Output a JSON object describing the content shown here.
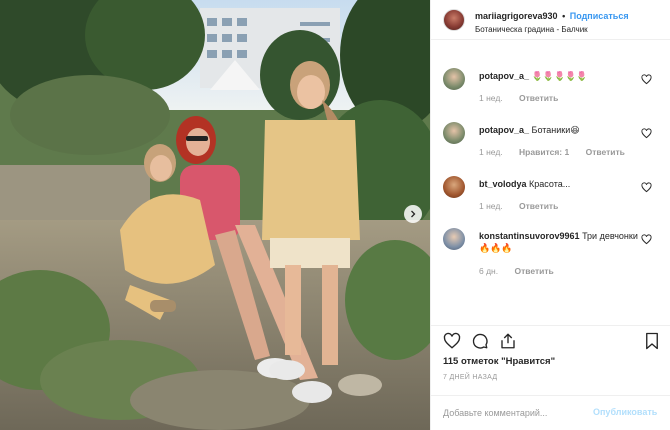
{
  "post": {
    "username": "mariiagrigoreva930",
    "separator": "•",
    "follow_label": "Подписаться",
    "location": "Ботаническа градина - Балчик"
  },
  "comments": [
    {
      "username": "potapov_a_",
      "text": "🌷🌷🌷🌷🌷",
      "time": "1 нед.",
      "likes": "",
      "reply": "Ответить"
    },
    {
      "username": "potapov_a_",
      "text": "Ботаники😆",
      "time": "1 нед.",
      "likes": "Нравится: 1",
      "reply": "Ответить"
    },
    {
      "username": "bt_volodya",
      "text": "Красота...",
      "time": "1 нед.",
      "likes": "",
      "reply": "Ответить"
    },
    {
      "username": "konstantinsuvorov9961",
      "text": "Три девчонки 🔥🔥🔥",
      "time": "6 дн.",
      "likes": "",
      "reply": "Ответить"
    }
  ],
  "likes_text": "115 отметок \"Нравится\"",
  "date_text": "7 ДНЕЙ НАЗАД",
  "comment_input": {
    "placeholder": "Добавьте комментарий...",
    "publish_label": "Опубликовать"
  },
  "icons": {
    "like": "heart-icon",
    "comment": "comment-bubble-icon",
    "share": "share-icon",
    "save": "bookmark-icon",
    "next": "chevron-right-icon"
  },
  "colors": {
    "link_blue": "#3897f0",
    "muted": "#999999",
    "publish_disabled": "#b2dffc",
    "text": "#262626"
  }
}
